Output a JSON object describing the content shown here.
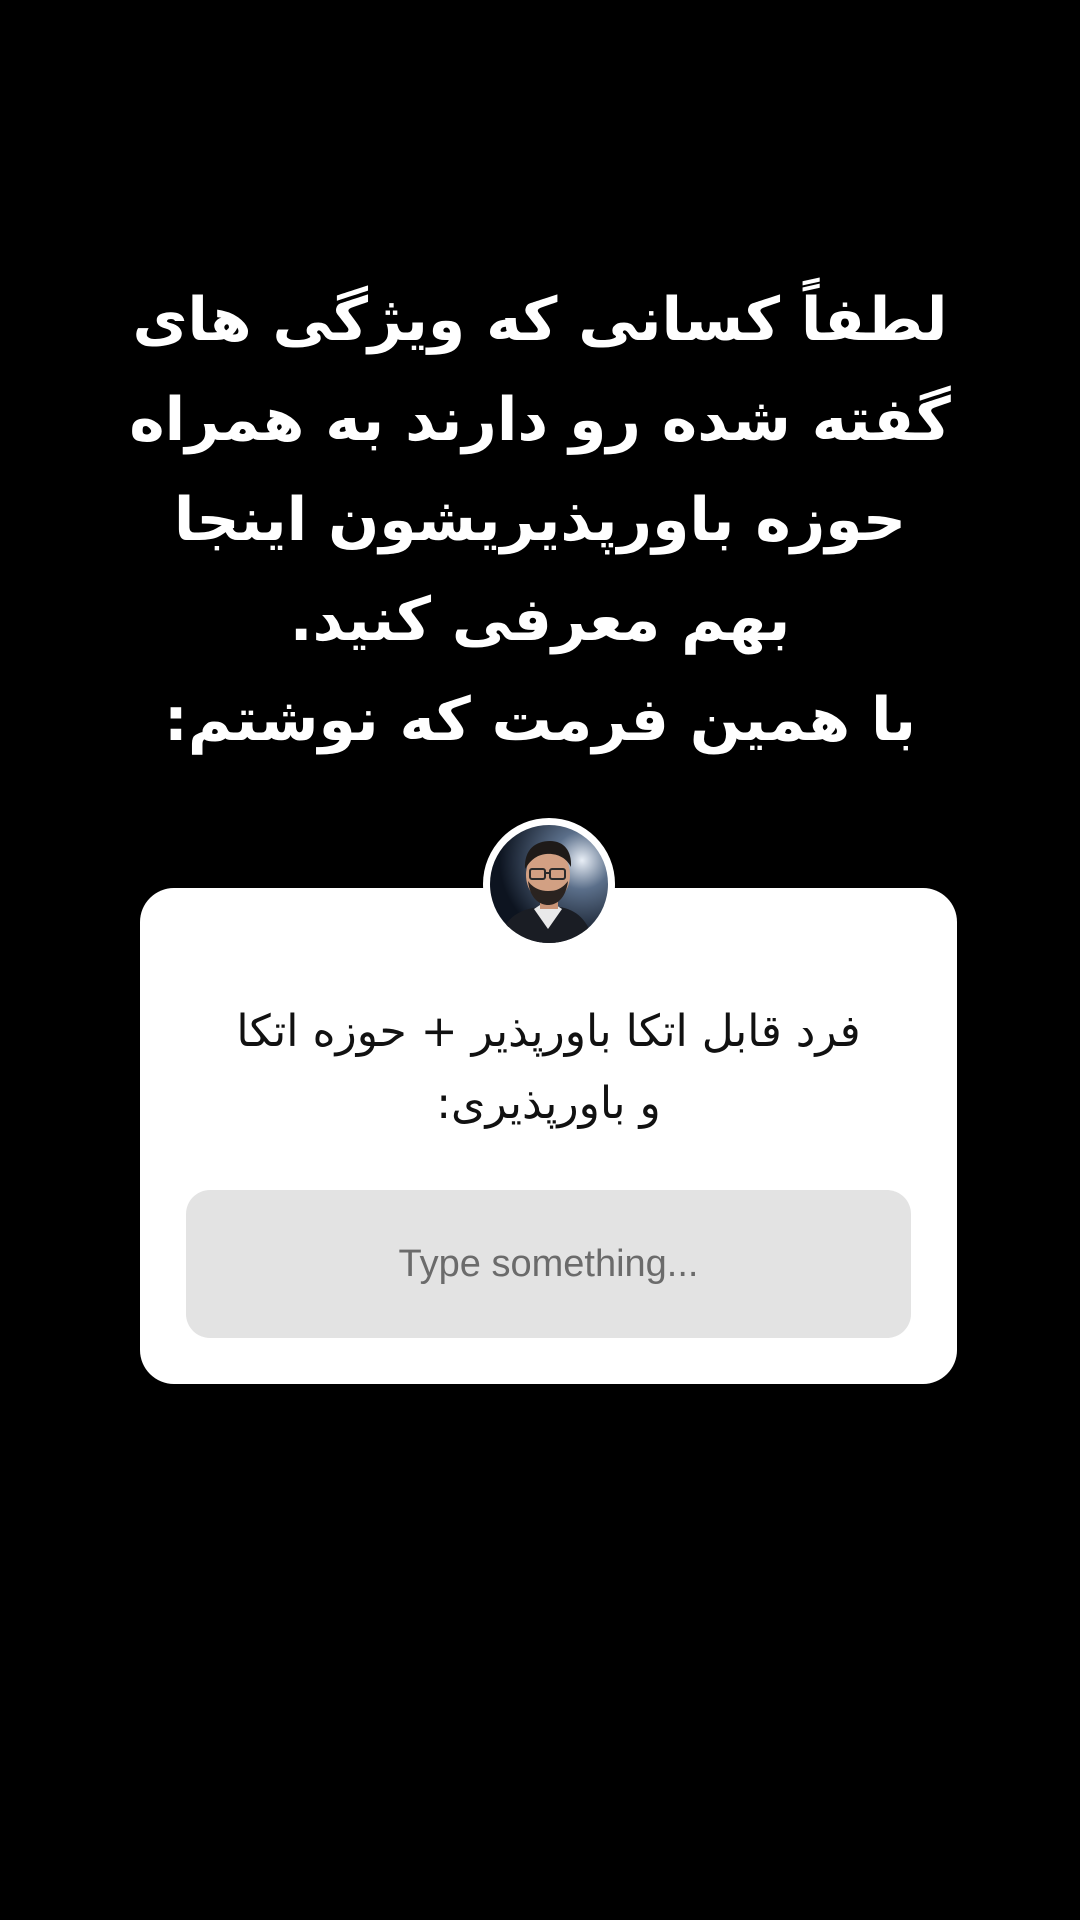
{
  "story": {
    "background_color": "#000000",
    "headline": {
      "lines": [
        "لطفاً کسانی که ویژگی های",
        "گفته شده رو دارند به همراه",
        "حوزه باورپذیریشون اینجا",
        "بهم معرفی کنید.",
        "با همین فرمت که نوشتم:"
      ],
      "color": "#ffffff"
    }
  },
  "question_sticker": {
    "background_color": "#ffffff",
    "avatar_icon": "user-photo-icon",
    "question_lines": [
      "فرد قابل اتکا باورپذیر + حوزه اتکا",
      "و باورپذیری:"
    ],
    "answer": {
      "value": "",
      "placeholder": "Type something...",
      "field_color": "#e3e3e3"
    }
  }
}
